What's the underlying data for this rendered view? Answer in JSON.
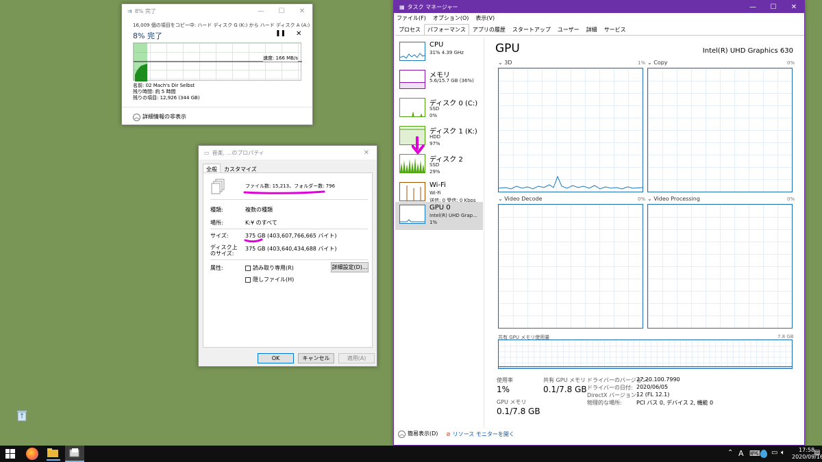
{
  "copy": {
    "title": "8% 完了",
    "line1": "16,009 個の項目をコピー中: ハード ディスク G (K:) から ハード ディスク A (A:)",
    "percent": "8% 完了",
    "speed": "速度: 166 MB/s",
    "name": "名前: 02 Mach's Dir Selbst",
    "remaining_time": "残り時間: 約 5 時間",
    "remaining_items": "残りの項目: 12,926 (344 GB)",
    "details": "詳細情報の非表示"
  },
  "props": {
    "title": "音楽, ...のプロパティ",
    "tab_general": "全般",
    "tab_custom": "カスタマイズ",
    "files": "ファイル数: 15,213、フォルダー数: 796",
    "type_label": "種類:",
    "type_value": "複数の種類",
    "location_label": "場所:",
    "location_value": "K:¥ のすべて",
    "size_label": "サイズ:",
    "size_value": "375 GB (403,607,766,665 バイト)",
    "disk_label1": "ディスク上",
    "disk_label2": "のサイズ:",
    "disk_value": "375 GB (403,640,434,688 バイト)",
    "attr_label": "属性:",
    "readonly": "読み取り専用(R)",
    "hidden": "隠しファイル(H)",
    "advanced": "詳細設定(D)...",
    "ok": "OK",
    "cancel": "キャンセル",
    "apply": "適用(A)"
  },
  "tm": {
    "title": "タスク マネージャー",
    "menu": [
      "ファイル(F)",
      "オプション(O)",
      "表示(V)"
    ],
    "tabs": [
      "プロセス",
      "パフォーマンス",
      "アプリの履歴",
      "スタートアップ",
      "ユーザー",
      "詳細",
      "サービス"
    ],
    "sidebar": [
      {
        "name": "CPU",
        "sub": "31% 4.39 GHz",
        "val": ""
      },
      {
        "name": "メモリ",
        "sub": "5.6/15.7 GB (36%)",
        "val": ""
      },
      {
        "name": "ディスク 0 (C:)",
        "sub": "SSD",
        "val": "0%"
      },
      {
        "name": "ディスク 1 (K:)",
        "sub": "HDD",
        "val": "97%"
      },
      {
        "name": "ディスク 2",
        "sub": "SSD",
        "val": "29%"
      },
      {
        "name": "Wi-Fi",
        "sub": "Wi-Fi",
        "val": "送信: 0 受信: 0 Kbps"
      },
      {
        "name": "GPU 0",
        "sub": "Intel(R) UHD Grap...",
        "val": "1%"
      }
    ],
    "heading": "GPU",
    "gpu_name": "Intel(R) UHD Graphics 630",
    "engines": [
      {
        "label": "3D",
        "pct": "1%"
      },
      {
        "label": "Copy",
        "pct": "0%"
      },
      {
        "label": "Video Decode",
        "pct": "0%"
      },
      {
        "label": "Video Processing",
        "pct": "0%"
      }
    ],
    "shared_mem_label": "共有 GPU メモリ使用量",
    "shared_mem_max": "7.8 GB",
    "util_label": "使用率",
    "util_value": "1%",
    "shared_label": "共有 GPU メモリ",
    "shared_value": "0.1/7.8 GB",
    "gpumem_label": "GPU メモリ",
    "gpumem_value": "0.1/7.8 GB",
    "driver_version_label": "ドライバーのバージョン:",
    "driver_version": "27.20.100.7990",
    "driver_date_label": "ドライバーの日付:",
    "driver_date": "2020/06/05",
    "directx_label": "DirectX バージョン:",
    "directx": "12 (FL 12.1)",
    "location_label": "物理的な場所:",
    "location": "PCI バス 0, デバイス 2, 機能 0",
    "simple_view": "簡易表示(D)",
    "resource_monitor": "リソース モニターを開く"
  },
  "taskbar": {
    "time": "17:58",
    "date": "2020/09/16",
    "ime": "A"
  },
  "colors": {
    "accent_purple": "#6b2fa8",
    "highlight": "#e000d8",
    "desktop": "#7a9656"
  }
}
